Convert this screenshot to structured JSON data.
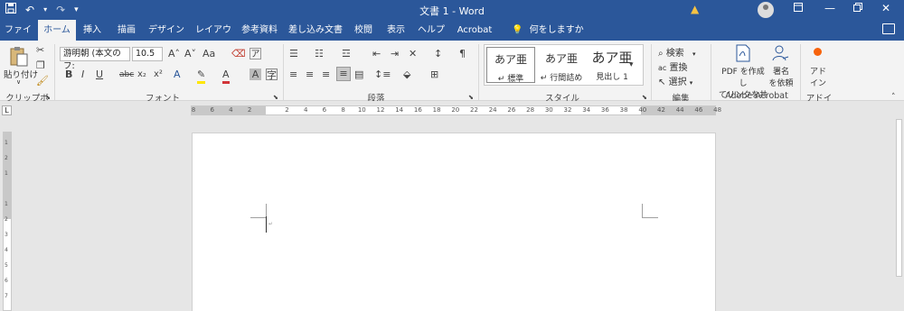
{
  "window": {
    "title": "文書 1  -  Word",
    "save_icon": "save-icon",
    "undo_icon": "undo-icon",
    "redo_icon": "redo-icon",
    "customize_icon": "customize-qat-icon",
    "warning_icon": "warning-icon",
    "controls": [
      "ribbon-display-icon",
      "minimize-icon",
      "restore-icon",
      "close-icon"
    ]
  },
  "tabs": [
    "ファイル",
    "ホーム",
    "挿入",
    "描画",
    "デザイン",
    "レイアウト",
    "参考資料",
    "差し込み文書",
    "校閲",
    "表示",
    "ヘルプ",
    "Acrobat"
  ],
  "active_tab": "ホーム",
  "tell_me": "何をしますか",
  "ribbon": {
    "clipboard": {
      "label": "クリップボード",
      "paste": "貼り付け",
      "paste_arrow": "∨"
    },
    "font": {
      "label": "フォント",
      "font_name": "游明朝 (本文のフ:",
      "font_size": "10.5",
      "aa": "Aa",
      "bold": "B",
      "italic": "I",
      "underline": "U",
      "strike": "abc",
      "sub": "x₂",
      "sup": "x²",
      "grow": "A˄",
      "shrink": "A˅"
    },
    "paragraph": {
      "label": "段落"
    },
    "styles": {
      "label": "スタイル",
      "items": [
        {
          "sample": "あア亜",
          "name": "↵ 標準"
        },
        {
          "sample": "あア亜",
          "name": "↵ 行間詰め"
        },
        {
          "sample": "あア亜",
          "name": "見出し 1"
        }
      ]
    },
    "editing": {
      "label": "編集",
      "find": "検索",
      "replace": "置換",
      "select": "選択"
    },
    "acrobat": {
      "label": "Adobe Acrobat",
      "create_pdf_line1": "PDF を作成し",
      "create_pdf_line2": "てリンクを共有",
      "request_sign_line1": "署名",
      "request_sign_line2": "を依頼"
    },
    "addins": {
      "label": "アドイン",
      "button_line1": "アド",
      "button_line2": "イン"
    }
  },
  "ruler": {
    "tab_selector": "L",
    "ticks": [
      "8",
      "6",
      "4",
      "2",
      "",
      "2",
      "4",
      "6",
      "8",
      "10",
      "12",
      "14",
      "16",
      "18",
      "20",
      "22",
      "24",
      "26",
      "28",
      "30",
      "32",
      "34",
      "36",
      "38",
      "40",
      "42",
      "44",
      "46",
      "48"
    ],
    "vticks": [
      "1",
      "2",
      "1",
      "",
      "1",
      "2",
      "3",
      "4",
      "5",
      "6",
      "7"
    ]
  },
  "colors": {
    "title_bar": "#2b579a",
    "ribbon_bg": "#f3f3f3",
    "canvas_bg": "#e6e6e6",
    "font_color_accent": "#d13438",
    "highlight_accent": "#ffe600",
    "addin_dot": "#f7630c"
  }
}
